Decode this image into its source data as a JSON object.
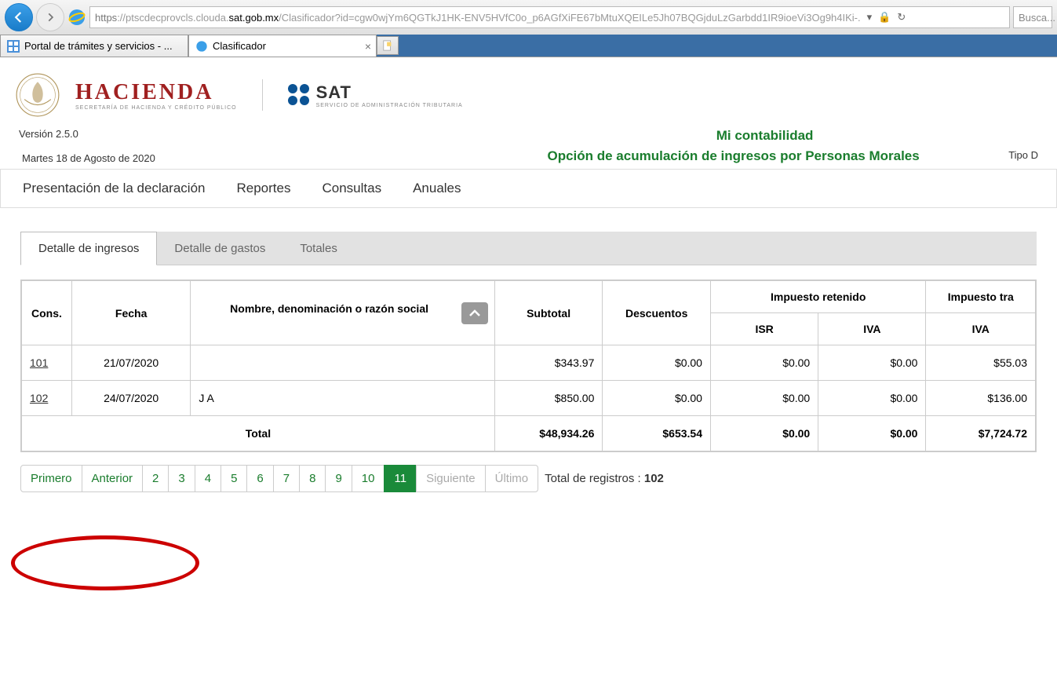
{
  "browser": {
    "url_prefix": "https",
    "url_mid": "://ptscdecprovcls.clouda.",
    "url_domain": "sat.gob.mx",
    "url_path": "/Clasificador?id=cgw0wjYm6QGTkJ1HK-ENV5HVfC0o_p6AGfXiFE67bMtuXQEILe5Jh07BQGjduLzGarbdd1IR9ioeVi3Og9h4IKi-.",
    "search_placeholder": "Busca...",
    "tab1": "Portal de trámites y servicios - ...",
    "tab2": "Clasificador"
  },
  "header": {
    "hacienda": "HACIENDA",
    "hacienda_sub": "SECRETARÍA DE HACIENDA Y CRÉDITO PÚBLICO",
    "sat": "SAT",
    "sat_sub": "SERVICIO DE ADMINISTRACIÓN TRIBUTARIA"
  },
  "meta": {
    "version": "Versión 2.5.0",
    "date": "Martes 18 de Agosto de 2020",
    "app_title": "Mi contabilidad",
    "app_subtitle": "Opción de acumulación de ingresos por Personas Morales",
    "tipo": "Tipo D"
  },
  "menu": {
    "m1": "Presentación de la declaración",
    "m2": "Reportes",
    "m3": "Consultas",
    "m4": "Anuales"
  },
  "inner_tabs": {
    "t1": "Detalle de ingresos",
    "t2": "Detalle de gastos",
    "t3": "Totales"
  },
  "table": {
    "h_cons": "Cons.",
    "h_fecha": "Fecha",
    "h_nombre": "Nombre, denominación o razón social",
    "h_subtotal": "Subtotal",
    "h_descuentos": "Descuentos",
    "h_imp_ret": "Impuesto retenido",
    "h_imp_tra": "Impuesto tra",
    "h_isr": "ISR",
    "h_iva": "IVA",
    "h_iva2": "IVA",
    "rows": [
      {
        "cons": "101",
        "fecha": "21/07/2020",
        "nombre": "",
        "subtotal": "$343.97",
        "desc": "$0.00",
        "isr": "$0.00",
        "iva": "$0.00",
        "iva2": "$55.03"
      },
      {
        "cons": "102",
        "fecha": "24/07/2020",
        "nombre": "J  A",
        "subtotal": "$850.00",
        "desc": "$0.00",
        "isr": "$0.00",
        "iva": "$0.00",
        "iva2": "$136.00"
      }
    ],
    "total_label": "Total",
    "total": {
      "subtotal": "$48,934.26",
      "desc": "$653.54",
      "isr": "$0.00",
      "iva": "$0.00",
      "iva2": "$7,724.72"
    }
  },
  "pager": {
    "first": "Primero",
    "prev": "Anterior",
    "pages": [
      "2",
      "3",
      "4",
      "5",
      "6",
      "7",
      "8",
      "9",
      "10",
      "11"
    ],
    "current": "11",
    "next": "Siguiente",
    "last": "Último",
    "total_label": "Total de registros : ",
    "total_count": "102"
  }
}
